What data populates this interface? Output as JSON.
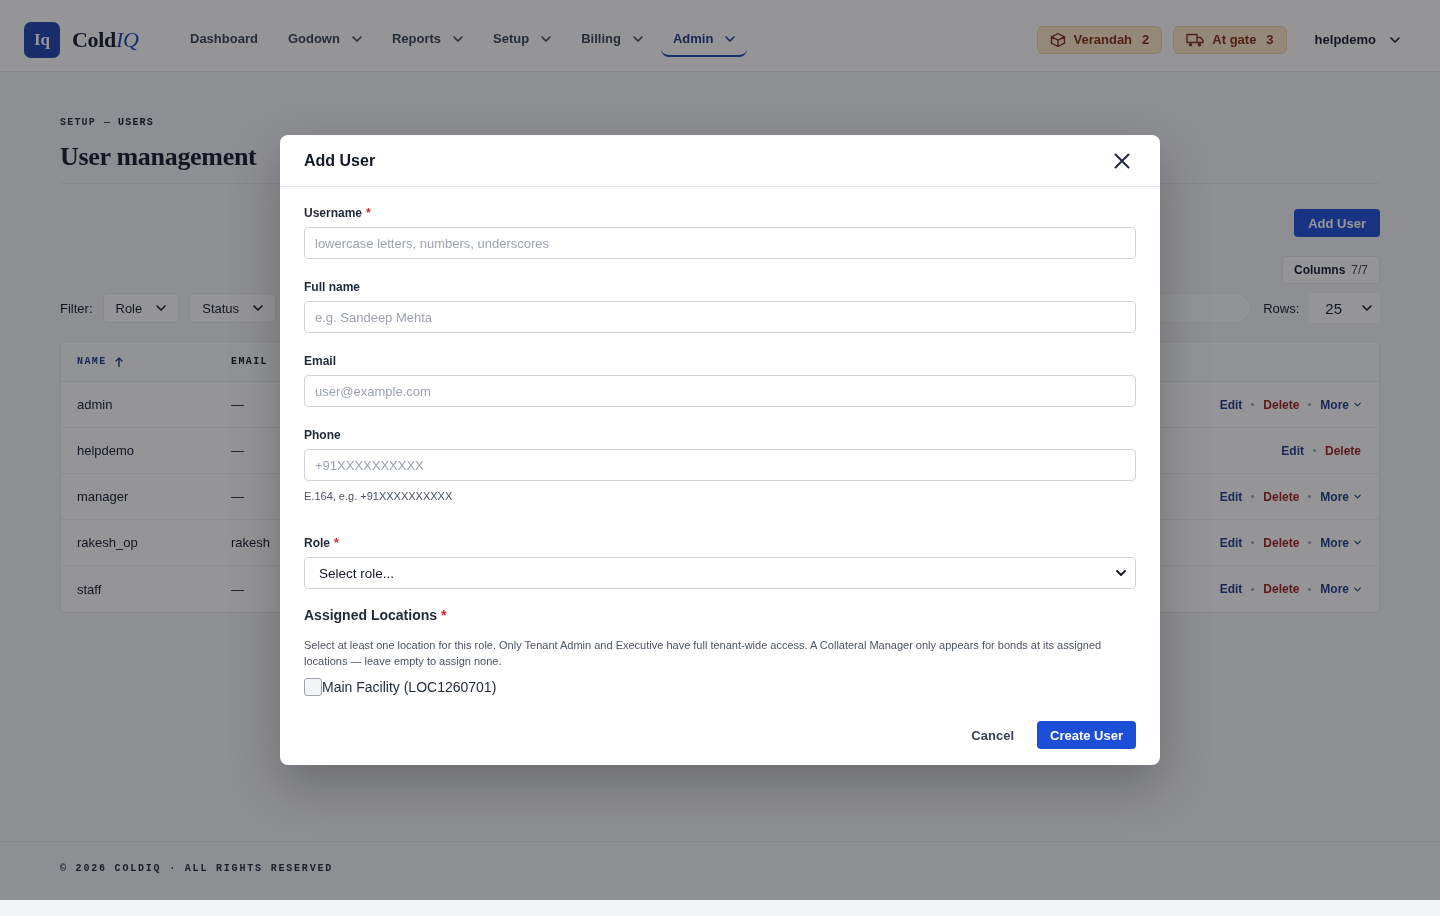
{
  "nav": {
    "logo_mark": "Iq",
    "brand": {
      "name": "Cold",
      "accent": "IQ"
    },
    "items": [
      {
        "label": "Dashboard",
        "has_menu": false,
        "selected": false
      },
      {
        "label": "Godown",
        "has_menu": true,
        "selected": false
      },
      {
        "label": "Reports",
        "has_menu": true,
        "selected": false
      },
      {
        "label": "Setup",
        "has_menu": true,
        "selected": false
      },
      {
        "label": "Billing",
        "has_menu": true,
        "selected": false
      },
      {
        "label": "Admin",
        "has_menu": true,
        "selected": true
      }
    ],
    "badges": [
      {
        "kind": "crate",
        "label": "Verandah",
        "count": "2"
      },
      {
        "kind": "truck",
        "label": "At gate",
        "count": "3"
      }
    ],
    "user": "helpdemo"
  },
  "page": {
    "breadcrumb": [
      "SETUP",
      "USERS"
    ],
    "title": "User management",
    "add_button": "Add User",
    "columns_button": {
      "label": "Columns",
      "count": "7/7"
    },
    "filter": {
      "label": "Filter:",
      "dropdowns": [
        "Role",
        "Status"
      ]
    },
    "rows": {
      "label": "Rows:",
      "value": "25"
    }
  },
  "table": {
    "columns": [
      {
        "label": "NAME",
        "sorted": true
      },
      {
        "label": "EMAIL",
        "sorted": false
      }
    ],
    "rows": [
      {
        "name": "admin",
        "email": "—",
        "actions": [
          {
            "kind": "edit",
            "label": "Edit"
          },
          {
            "kind": "delete",
            "label": "Delete"
          },
          {
            "kind": "more",
            "label": "More"
          }
        ]
      },
      {
        "name": "helpdemo",
        "email": "—",
        "actions": [
          {
            "kind": "edit",
            "label": "Edit"
          },
          {
            "kind": "delete",
            "label": "Delete"
          }
        ]
      },
      {
        "name": "manager",
        "email": "—",
        "actions": [
          {
            "kind": "edit",
            "label": "Edit"
          },
          {
            "kind": "delete",
            "label": "Delete"
          },
          {
            "kind": "more",
            "label": "More"
          }
        ]
      },
      {
        "name": "rakesh_op",
        "email": "rakesh",
        "actions": [
          {
            "kind": "edit",
            "label": "Edit"
          },
          {
            "kind": "delete",
            "label": "Delete"
          },
          {
            "kind": "more",
            "label": "More"
          }
        ]
      },
      {
        "name": "staff",
        "email": "—",
        "actions": [
          {
            "kind": "edit",
            "label": "Edit"
          },
          {
            "kind": "delete",
            "label": "Delete"
          },
          {
            "kind": "more",
            "label": "More"
          }
        ]
      }
    ]
  },
  "footer": "© 2026 COLDIQ · ALL RIGHTS RESERVED",
  "dialog": {
    "title": "Add User",
    "fields": [
      {
        "kind": "text",
        "label": "Username",
        "required_mark": "*",
        "placeholder": "lowercase letters, numbers, underscores"
      },
      {
        "kind": "text",
        "label": "Full name",
        "placeholder": "e.g. Sandeep Mehta"
      },
      {
        "kind": "text",
        "label": "Email",
        "placeholder": "user@example.com"
      },
      {
        "kind": "text",
        "label": "Phone",
        "placeholder": "+91XXXXXXXXXX",
        "hint": "E.164, e.g. +91XXXXXXXXXX"
      },
      {
        "kind": "select",
        "label": "Role",
        "required_mark": "*",
        "value": "Select role..."
      }
    ],
    "locations": {
      "title": "Assigned Locations",
      "required_mark": "*",
      "description": "Select at least one location for this role. Only Tenant Admin and Executive have full tenant-wide access. A Collateral Manager only appears for bonds at its assigned locations — leave empty to assign none.",
      "options": [
        {
          "label": "Main Facility (LOC1260701)",
          "checked": false
        }
      ]
    },
    "buttons": [
      {
        "kind": "secondary",
        "label": "Cancel"
      },
      {
        "kind": "primary",
        "label": "Create User"
      }
    ]
  }
}
